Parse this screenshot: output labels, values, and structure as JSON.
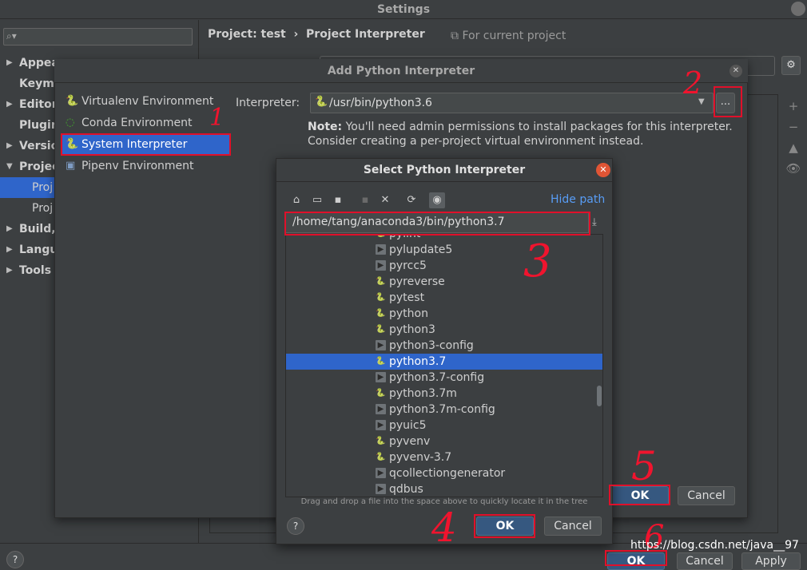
{
  "settings": {
    "title": "Settings",
    "search_icon": "search-icon",
    "sidebar": [
      {
        "label": "Appea",
        "arrow": "▶"
      },
      {
        "label": "Keyma",
        "arrow": ""
      },
      {
        "label": "Editor",
        "arrow": "▶"
      },
      {
        "label": "Plugin",
        "arrow": ""
      },
      {
        "label": "Versio",
        "arrow": "▶"
      },
      {
        "label": "Projec",
        "arrow": "▼"
      },
      {
        "label": "Proj",
        "arrow": ""
      },
      {
        "label": "Proj",
        "arrow": ""
      },
      {
        "label": "Build,",
        "arrow": "▶"
      },
      {
        "label": "Langu",
        "arrow": "▶"
      },
      {
        "label": "Tools",
        "arrow": "▶"
      }
    ],
    "breadcrumb_project": "Project: test",
    "breadcrumb_sep": "›",
    "breadcrumb_page": "Project Interpreter",
    "for_current_project": "⧉ For current project",
    "bottom_ok": "OK",
    "bottom_cancel": "Cancel",
    "bottom_apply": "Apply",
    "help": "?"
  },
  "add_dialog": {
    "title": "Add Python Interpreter",
    "environments": [
      {
        "label": "Virtualenv Environment",
        "icon": "python-icon"
      },
      {
        "label": "Conda Environment",
        "icon": "conda-icon"
      },
      {
        "label": "System Interpreter",
        "icon": "python-icon"
      },
      {
        "label": "Pipenv Environment",
        "icon": "pipenv-icon"
      }
    ],
    "interpreter_label": "Interpreter:",
    "interpreter_value": "/usr/bin/python3.6",
    "browse_label": "...",
    "note_bold": "Note:",
    "note_text": " You'll need admin permissions to install packages for this interpreter. Consider creating a per-project virtual environment instead.",
    "ok": "OK",
    "cancel": "Cancel"
  },
  "select_dialog": {
    "title": "Select Python Interpreter",
    "hide_path": "Hide path",
    "path": "/home/tang/anaconda3/bin/python3.7",
    "files": [
      {
        "name": "pylint",
        "type": "python"
      },
      {
        "name": "pylupdate5",
        "type": "exec"
      },
      {
        "name": "pyrcc5",
        "type": "exec"
      },
      {
        "name": "pyreverse",
        "type": "python"
      },
      {
        "name": "pytest",
        "type": "python"
      },
      {
        "name": "python",
        "type": "python"
      },
      {
        "name": "python3",
        "type": "python"
      },
      {
        "name": "python3-config",
        "type": "exec"
      },
      {
        "name": "python3.7",
        "type": "python"
      },
      {
        "name": "python3.7-config",
        "type": "exec"
      },
      {
        "name": "python3.7m",
        "type": "python"
      },
      {
        "name": "python3.7m-config",
        "type": "exec"
      },
      {
        "name": "pyuic5",
        "type": "exec"
      },
      {
        "name": "pyvenv",
        "type": "python"
      },
      {
        "name": "pyvenv-3.7",
        "type": "python"
      },
      {
        "name": "qcollectiongenerator",
        "type": "exec"
      },
      {
        "name": "qdbus",
        "type": "exec"
      }
    ],
    "selected": "python3.7",
    "drag_hint": "Drag and drop a file into the space above to quickly locate it in the tree",
    "ok": "OK",
    "cancel": "Cancel",
    "help": "?"
  },
  "annotations": [
    "1",
    "2",
    "3",
    "4",
    "5",
    "6"
  ],
  "watermark": "https://blog.csdn.net/java__97",
  "colors": {
    "accent": "#2f65ca",
    "highlight": "#e0102a",
    "link": "#589df6"
  }
}
